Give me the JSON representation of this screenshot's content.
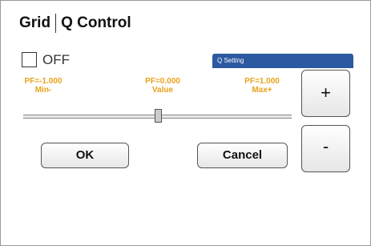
{
  "dialog": {
    "title_left": "Grid",
    "title_right": "Q Control",
    "off_label": "OFF",
    "qsetting_label": "Q Setting"
  },
  "panel": {
    "pf_min_value": "PF=-1.000",
    "pf_min_label": "Min-",
    "pf_value_value": "PF=0.000",
    "pf_value_label": "Value",
    "pf_max_value": "PF=1.000",
    "pf_max_label": "Max+",
    "slider_value": 0.5
  },
  "buttons": {
    "ok": "OK",
    "cancel": "Cancel",
    "plus": "+",
    "minus": "-"
  },
  "colors": {
    "accent_orange": "#e8a21a",
    "header_blue": "#2c5aa0"
  }
}
